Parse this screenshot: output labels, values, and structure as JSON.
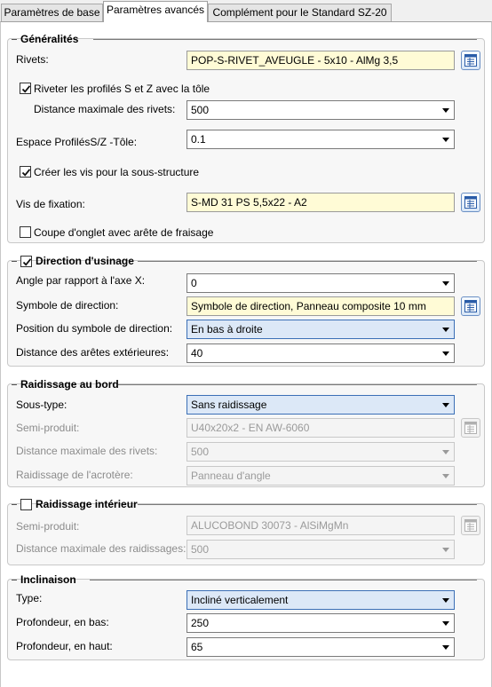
{
  "tabs": [
    {
      "label": "Paramètres de base"
    },
    {
      "label": "Paramètres avancés"
    },
    {
      "label": "Complément pour le Standard SZ-20"
    }
  ],
  "generalites": {
    "title": "Généralités",
    "rivets_label": "Rivets:",
    "rivets_value": "POP-S-RIVET_AVEUGLE -  5x10 - AlMg 3,5",
    "riveter_label": "Riveter les profilés S et Z avec la tôle",
    "riveter_checked": true,
    "distance_label": "Distance maximale des rivets:",
    "distance_value": "500",
    "espace_label": "Espace ProfilésS/Z -Tôle:",
    "espace_value": "0.1",
    "creer_vis_label": "Créer les vis pour la sous-structure",
    "creer_vis_checked": true,
    "vis_label": "Vis de fixation:",
    "vis_value": "S-MD 31 PS 5,5x22 - A2",
    "coupe_label": "Coupe d'onglet avec arête de fraisage",
    "coupe_checked": false
  },
  "direction": {
    "title": "Direction d'usinage",
    "checked": true,
    "angle_label": "Angle par rapport à l'axe X:",
    "angle_value": "0",
    "symbole_label": "Symbole de direction:",
    "symbole_value": "Symbole de direction, Panneau composite 10 mm",
    "position_label": "Position du symbole de direction:",
    "position_value": "En bas à droite",
    "distance_label": "Distance des arêtes extérieures:",
    "distance_value": "40"
  },
  "raidissage_bord": {
    "title": "Raidissage au bord",
    "soustype_label": "Sous-type:",
    "soustype_value": "Sans raidissage",
    "semi_label": "Semi-produit:",
    "semi_value": "U40x20x2 - EN AW-6060",
    "distance_label": "Distance maximale des rivets:",
    "distance_value": "500",
    "acrotere_label": "Raidissage de l'acrotère:",
    "acrotere_value": "Panneau d'angle"
  },
  "raidissage_interieur": {
    "title": "Raidissage intérieur",
    "checked": false,
    "semi_label": "Semi-produit:",
    "semi_value": "ALUCOBOND 30073 - AlSiMgMn",
    "distance_label": "Distance maximale des raidissages:",
    "distance_value": "500"
  },
  "inclinaison": {
    "title": "Inclinaison",
    "type_label": "Type:",
    "type_value": "Incliné verticalement",
    "bas_label": "Profondeur, en bas:",
    "bas_value": "250",
    "haut_label": "Profondeur, en haut:",
    "haut_value": "65"
  }
}
